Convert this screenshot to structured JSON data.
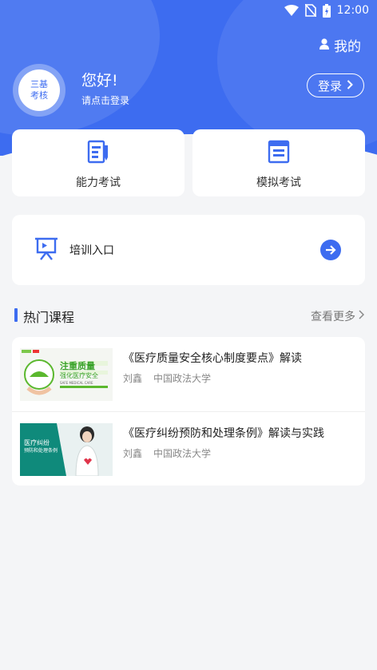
{
  "status_bar": {
    "time": "12:00"
  },
  "header": {
    "mine_label": "我的",
    "avatar_text": [
      "三基",
      "考核"
    ],
    "greeting": "您好!",
    "login_prompt": "请点击登录",
    "login_button": "登录"
  },
  "quick_actions": [
    {
      "label": "能力考试",
      "icon": "exam-paper-icon"
    },
    {
      "label": "模拟考试",
      "icon": "mock-paper-icon"
    }
  ],
  "training": {
    "label": "培训入口",
    "icon": "training-board-icon"
  },
  "popular": {
    "title": "热门课程",
    "more": "查看更多",
    "courses": [
      {
        "title": "《医疗质量安全核心制度要点》解读",
        "teacher": "刘鑫",
        "org": "中国政法大学",
        "thumb_text": [
          "注重质量",
          "强化医疗安全",
          "SAFE MEDICAL CARE"
        ]
      },
      {
        "title": "《医疗纠纷预防和处理条例》解读与实践",
        "teacher": "刘鑫",
        "org": "中国政法大学",
        "thumb_text": [
          "医疗纠纷",
          "预防和处理条例"
        ]
      }
    ]
  },
  "colors": {
    "accent": "#3d6cf0",
    "background": "#f4f5f7"
  }
}
